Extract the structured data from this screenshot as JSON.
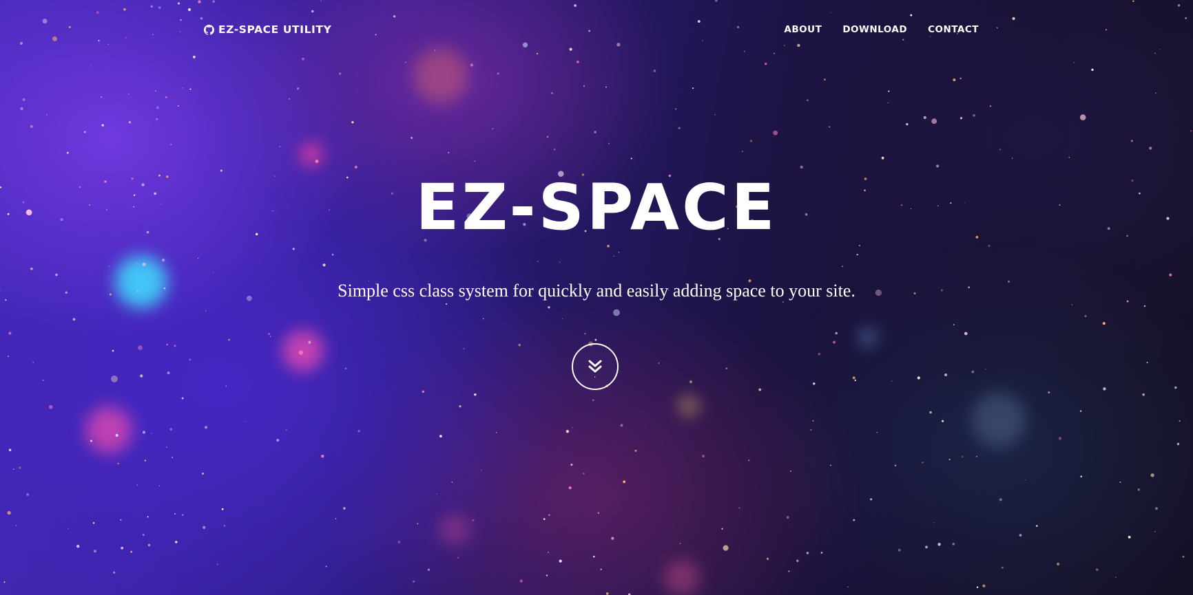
{
  "nav": {
    "brand_label": "EZ-SPACE UTILITY",
    "brand_icon": "github-icon",
    "links": [
      {
        "label": "ABOUT"
      },
      {
        "label": "DOWNLOAD"
      },
      {
        "label": "CONTACT"
      }
    ]
  },
  "hero": {
    "title": "EZ-SPACE",
    "subtitle": "Simple css class system for quickly and easily adding space to your site.",
    "scroll_icon": "double-chevron-down-icon"
  },
  "colors": {
    "text": "#ffffff",
    "background_primary": "#3b22a6",
    "background_dark": "#141126"
  }
}
